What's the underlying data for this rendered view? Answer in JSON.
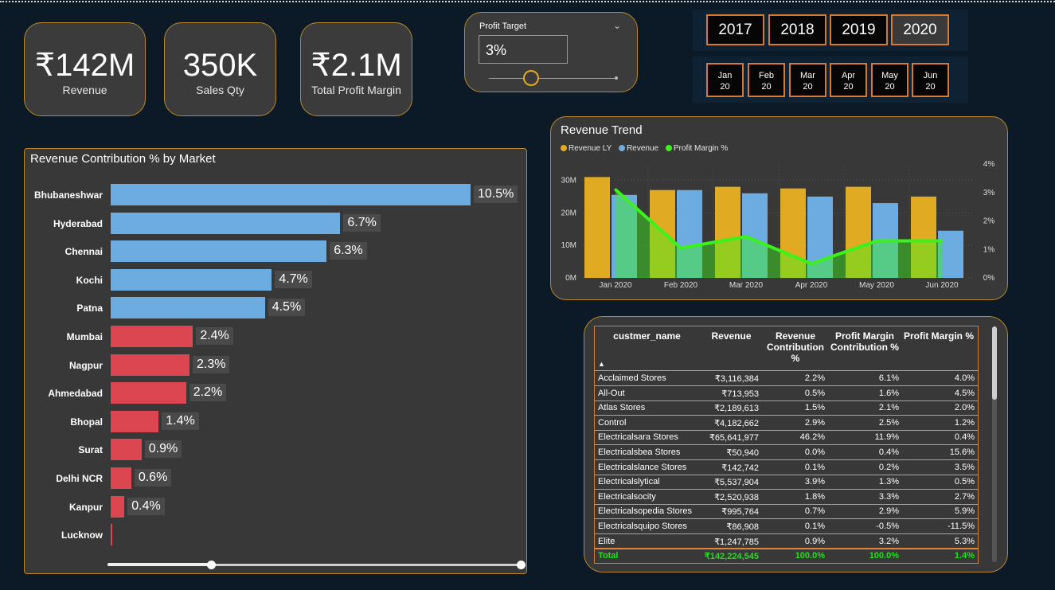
{
  "kpis": [
    {
      "value": "₹142M",
      "label": "Revenue"
    },
    {
      "value": "350K",
      "label": "Sales Qty"
    },
    {
      "value": "₹2.1M",
      "label": "Total Profit Margin"
    }
  ],
  "profit_target": {
    "title": "Profit Target",
    "value": "3%",
    "slider_level": 0.33
  },
  "years": [
    "2017",
    "2018",
    "2019",
    "2020"
  ],
  "selected_year": "2020",
  "months": [
    {
      "m": "Jan",
      "y": "20"
    },
    {
      "m": "Feb",
      "y": "20"
    },
    {
      "m": "Mar",
      "y": "20"
    },
    {
      "m": "Apr",
      "y": "20"
    },
    {
      "m": "May",
      "y": "20"
    },
    {
      "m": "Jun",
      "y": "20"
    }
  ],
  "colors": {
    "above_target": "#6cace0",
    "below_target": "#dc4650",
    "revenue_ly": "#e0ab22",
    "revenue": "#6cace0",
    "profit_margin": "#3cf21c",
    "accent": "#d67a2f"
  },
  "chart_data": [
    {
      "type": "bar",
      "title": "Revenue Contribution % by Market",
      "categories": [
        "Bhubaneshwar",
        "Hyderabad",
        "Chennai",
        "Kochi",
        "Patna",
        "Mumbai",
        "Nagpur",
        "Ahmedabad",
        "Bhopal",
        "Surat",
        "Delhi NCR",
        "Kanpur",
        "Lucknow"
      ],
      "values": [
        10.5,
        6.7,
        6.3,
        4.7,
        4.5,
        2.4,
        2.3,
        2.2,
        1.4,
        0.9,
        0.6,
        0.4,
        0.05
      ],
      "labels": [
        "10.5%",
        "6.7%",
        "6.3%",
        "4.7%",
        "4.5%",
        "2.4%",
        "2.3%",
        "2.2%",
        "1.4%",
        "0.9%",
        "0.6%",
        "0.4%",
        ""
      ],
      "xlim": [
        0,
        10.5
      ],
      "grid": false,
      "scroll_level": 0.25
    },
    {
      "type": "bar",
      "title": "Revenue Trend",
      "categories": [
        "Jan 2020",
        "Feb 2020",
        "Mar 2020",
        "Apr 2020",
        "May 2020",
        "Jun 2020"
      ],
      "series": [
        {
          "name": "Revenue LY",
          "values": [
            31,
            27,
            28,
            27.5,
            28,
            25
          ]
        },
        {
          "name": "Revenue",
          "values": [
            25.5,
            27,
            26,
            25,
            23,
            14.5
          ]
        },
        {
          "name": "Profit Margin %",
          "type": "line",
          "values": [
            3.1,
            1.05,
            1.45,
            0.5,
            1.3,
            1.3
          ]
        }
      ],
      "y_ticks": [
        "0M",
        "10M",
        "20M",
        "30M"
      ],
      "ylim": [
        0,
        35
      ],
      "y2_ticks": [
        "0%",
        "1%",
        "2%",
        "3%",
        "4%"
      ],
      "y2lim": [
        0,
        4
      ],
      "legend": "top-left",
      "grid": true
    }
  ],
  "table": {
    "headers": [
      "custmer_name",
      "Revenue",
      "Revenue Contribution %",
      "Profit Margin Contribution %",
      "Profit Margin %"
    ],
    "sort_indicator": "▲",
    "rows": [
      [
        "Acclaimed Stores",
        "₹3,116,384",
        "2.2%",
        "6.1%",
        "4.0%"
      ],
      [
        "All-Out",
        "₹713,953",
        "0.5%",
        "1.6%",
        "4.5%"
      ],
      [
        "Atlas Stores",
        "₹2,189,613",
        "1.5%",
        "2.1%",
        "2.0%"
      ],
      [
        "Control",
        "₹4,182,662",
        "2.9%",
        "2.5%",
        "1.2%"
      ],
      [
        "Electricalsara Stores",
        "₹65,641,977",
        "46.2%",
        "11.9%",
        "0.4%"
      ],
      [
        "Electricalsbea Stores",
        "₹50,940",
        "0.0%",
        "0.4%",
        "15.6%"
      ],
      [
        "Electricalslance Stores",
        "₹142,742",
        "0.1%",
        "0.2%",
        "3.5%"
      ],
      [
        "Electricalslytical",
        "₹5,537,904",
        "3.9%",
        "1.3%",
        "0.5%"
      ],
      [
        "Electricalsocity",
        "₹2,520,938",
        "1.8%",
        "3.3%",
        "2.7%"
      ],
      [
        "Electricalsopedia Stores",
        "₹995,764",
        "0.7%",
        "2.9%",
        "5.9%"
      ],
      [
        "Electricalsquipo Stores",
        "₹86,908",
        "0.1%",
        "-0.5%",
        "-11.5%"
      ],
      [
        "Elite",
        "₹1,247,785",
        "0.9%",
        "3.2%",
        "5.3%"
      ]
    ],
    "total": [
      "Total",
      "₹142,224,545",
      "100.0%",
      "100.0%",
      "1.4%"
    ]
  }
}
